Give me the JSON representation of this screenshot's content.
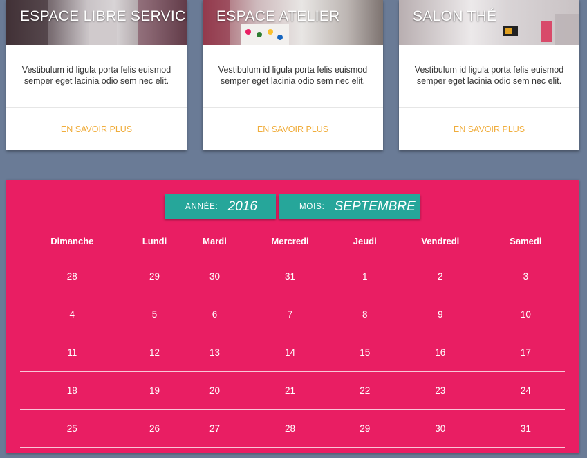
{
  "cards": [
    {
      "title": "ESPACE LIBRE SERVICE",
      "text": "Vestibulum id ligula porta felis euismod semper eget lacinia odio sem nec elit.",
      "link": "EN SAVOIR PLUS"
    },
    {
      "title": "ESPACE ATELIER",
      "text": "Vestibulum id ligula porta felis euismod semper eget lacinia odio sem nec elit.",
      "link": "EN SAVOIR PLUS"
    },
    {
      "title": "SALON THÉ",
      "text": "Vestibulum id ligula porta felis euismod semper eget lacinia odio sem nec elit.",
      "link": "EN SAVOIR PLUS"
    }
  ],
  "calendar": {
    "year_label": "ANNÉE:",
    "year": "2016",
    "month_label": "MOIS:",
    "month": "SEPTEMBRE",
    "days": [
      "Dimanche",
      "Lundi",
      "Mardi",
      "Mercredi",
      "Jeudi",
      "Vendredi",
      "Samedi"
    ],
    "weeks": [
      [
        "28",
        "29",
        "30",
        "31",
        "1",
        "2",
        "3"
      ],
      [
        "4",
        "5",
        "6",
        "7",
        "8",
        "9",
        "10"
      ],
      [
        "11",
        "12",
        "13",
        "14",
        "15",
        "16",
        "17"
      ],
      [
        "18",
        "19",
        "20",
        "21",
        "22",
        "23",
        "24"
      ],
      [
        "25",
        "26",
        "27",
        "28",
        "29",
        "30",
        "31"
      ]
    ]
  },
  "colors": {
    "background": "#6a7b96",
    "calendar_bg": "#e91e63",
    "selector_bg": "#26a69a",
    "link": "#f0ad3c"
  }
}
